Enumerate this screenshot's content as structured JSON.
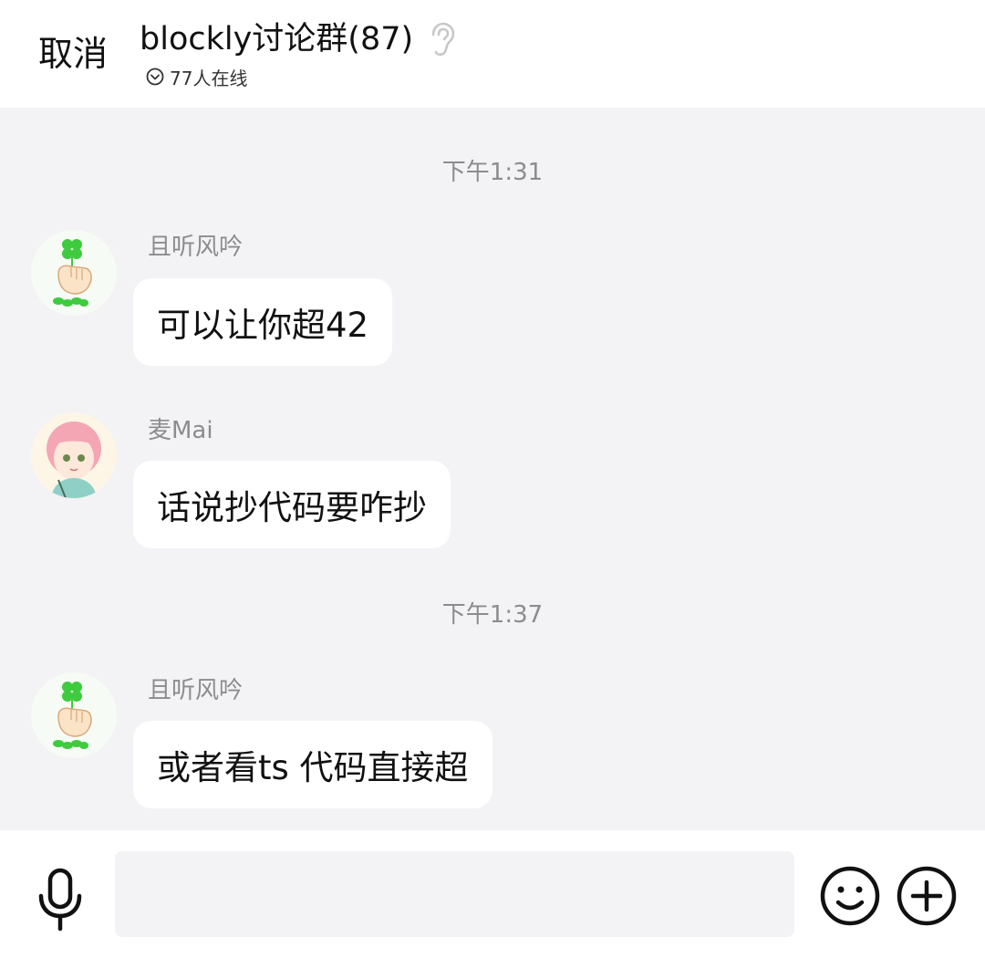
{
  "header": {
    "cancel_label": "取消",
    "title": "blockly讨论群(87)",
    "online_text": "77人在线",
    "ear_icon": "ear-icon",
    "online_icon": "chevron-circle-down-icon"
  },
  "messages": [
    {
      "type": "time",
      "text": "下午1:31"
    },
    {
      "type": "msg",
      "sender": "且听风吟",
      "text": "可以让你超42",
      "avatar": "clover-hand-avatar"
    },
    {
      "type": "msg",
      "sender": "麦Mai",
      "text": "话说抄代码要咋抄",
      "avatar": "anime-girl-avatar"
    },
    {
      "type": "time",
      "text": "下午1:37"
    },
    {
      "type": "msg",
      "sender": "且听风吟",
      "text": "或者看ts 代码直接超",
      "avatar": "clover-hand-avatar"
    }
  ],
  "bottom": {
    "mic_icon": "microphone-icon",
    "input_value": "",
    "emoji_icon": "smiley-icon",
    "plus_icon": "plus-circle-icon"
  },
  "colors": {
    "background": "#f3f2f5",
    "bubble": "#ffffff",
    "meta_text": "#8c8c8c",
    "clover_green": "#3ecb3e",
    "avatar_hair_pink": "#f4a6b4"
  }
}
